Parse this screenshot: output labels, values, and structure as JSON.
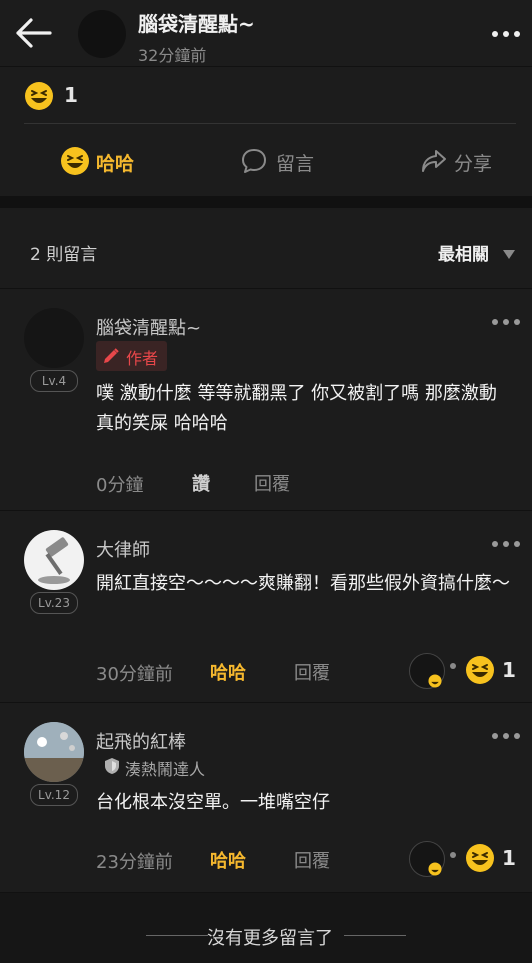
{
  "header": {
    "title": "腦袋清醒點~",
    "time": "32分鐘前"
  },
  "post": {
    "reaction_count": "1",
    "actions": {
      "haha": "哈哈",
      "comment": "留言",
      "share": "分享"
    }
  },
  "comments_header": {
    "count": "2 則留言",
    "sort": "最相關"
  },
  "comments": [
    {
      "name": "腦袋清醒點~",
      "level": "Lv.4",
      "badge": "作者",
      "text": "噗 激動什麼 等等就翻黑了 你又被割了嗎 那麼激動 真的笑屎 哈哈哈",
      "time": "0分鐘",
      "like": "讚",
      "reply": "回覆"
    },
    {
      "name": "大律師",
      "level": "Lv.23",
      "text": "開紅直接空～～～～爽賺翻！看那些假外資搞什麼～",
      "time": "30分鐘前",
      "like": "哈哈",
      "reply": "回覆",
      "reaction_count": "1"
    },
    {
      "name": "起飛的紅棒",
      "level": "Lv.12",
      "title": "湊熱鬧達人",
      "text": "台化根本沒空單。一堆嘴空仔",
      "time": "23分鐘前",
      "like": "哈哈",
      "reply": "回覆",
      "reaction_count": "1"
    }
  ],
  "footer": {
    "text": "沒有更多留言了"
  },
  "colors": {
    "background": "#1c1c1c",
    "accent_haha": "#f5b82e",
    "author_red": "#e8474a"
  },
  "icons": [
    "back-arrow-icon",
    "more-icon",
    "laughing-emoji-icon",
    "comment-bubble-icon",
    "share-arrow-icon",
    "pencil-icon",
    "shield-icon",
    "sort-caret-icon"
  ]
}
